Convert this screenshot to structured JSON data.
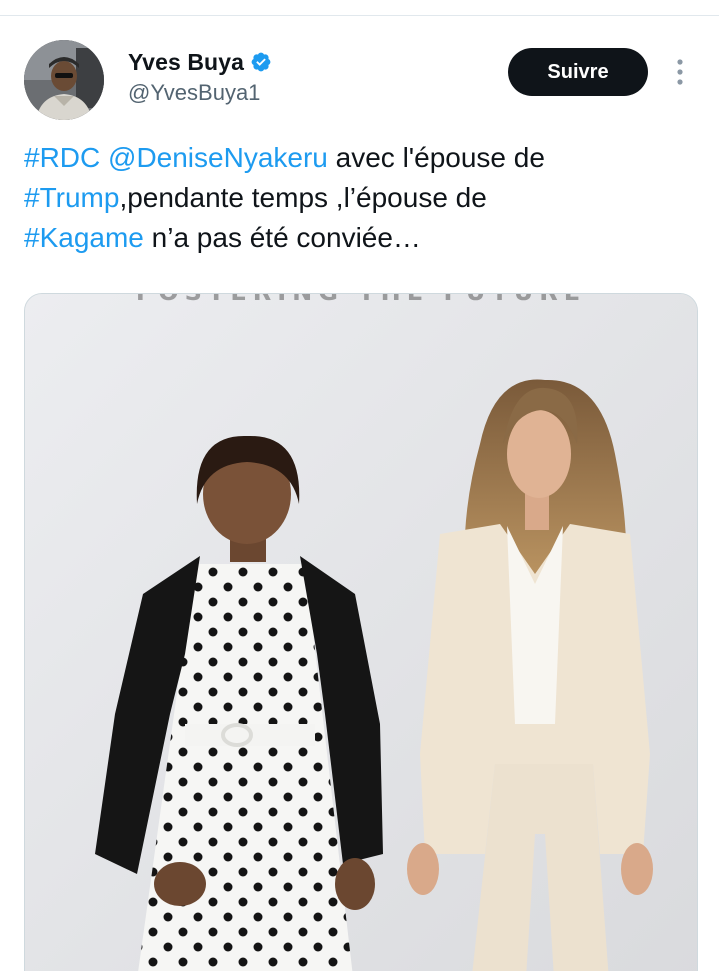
{
  "tweet": {
    "author": {
      "display_name": "Yves Buya",
      "handle": "@YvesBuya1",
      "verified": true,
      "avatar_icon": "profile-photo"
    },
    "follow_label": "Suivre",
    "more_icon": "more-vertical-icon",
    "text": {
      "segments": [
        {
          "text": "#RDC",
          "link": true
        },
        {
          "text": " ",
          "link": false
        },
        {
          "text": "@DeniseNyakeru",
          "link": true
        },
        {
          "text": " avec l'épouse de ",
          "link": false
        },
        {
          "text": "#Trump",
          "link": true
        },
        {
          "text": ",pendante temps ,l’épouse de ",
          "link": false
        },
        {
          "text": "#Kagame",
          "link": true
        },
        {
          "text": " n’a pas été conviée…",
          "link": false
        }
      ]
    },
    "media": {
      "banner_text": "FOSTERING THE FUTURE"
    }
  },
  "colors": {
    "link": "#1d9bf0",
    "text": "#0f1419",
    "secondary": "#536471",
    "button_bg": "#0f1419",
    "verified": "#1d9bf0"
  }
}
